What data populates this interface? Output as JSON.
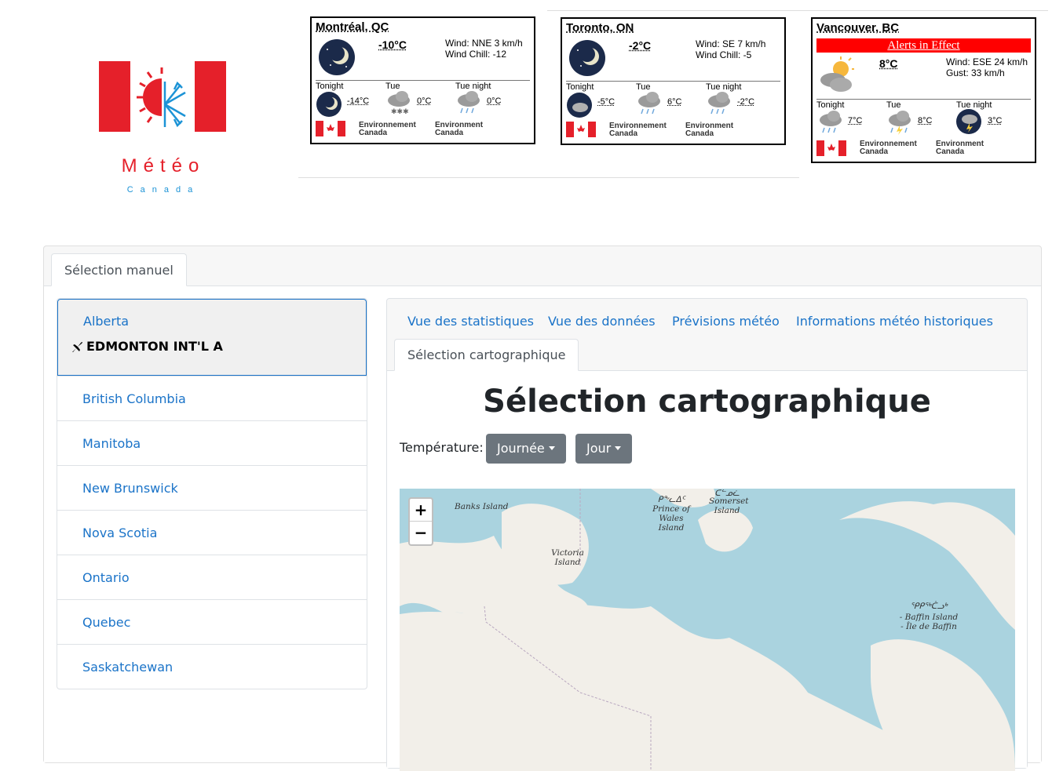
{
  "logo": {
    "word": "Météo",
    "sub": "Canada"
  },
  "weather_widgets": [
    {
      "city": "Montréal, QC",
      "temp": "-10°C",
      "wind": "Wind: NNE 3 km/h",
      "extra": "Wind Chill: -12",
      "alert": "",
      "periods": [
        {
          "label": "Tonight",
          "temp": "-14°C"
        },
        {
          "label": "Tue",
          "temp": "0°C"
        },
        {
          "label": "Tue night",
          "temp": "0°C"
        }
      ],
      "ec_fr": "Environnement Canada",
      "ec_en": "Environment Canada"
    },
    {
      "city": "Toronto, ON",
      "temp": "-2°C",
      "wind": "Wind: SE 7 km/h",
      "extra": "Wind Chill: -5",
      "alert": "",
      "periods": [
        {
          "label": "Tonight",
          "temp": "-5°C"
        },
        {
          "label": "Tue",
          "temp": "6°C"
        },
        {
          "label": "Tue night",
          "temp": "-2°C"
        }
      ],
      "ec_fr": "Environnement Canada",
      "ec_en": "Environment Canada"
    },
    {
      "city": "Vancouver, BC",
      "temp": "8°C",
      "wind": "Wind: ESE 24 km/h",
      "extra": "Gust: 33 km/h",
      "alert": "Alerts in Effect",
      "periods": [
        {
          "label": "Tonight",
          "temp": "7°C"
        },
        {
          "label": "Tue",
          "temp": "8°C"
        },
        {
          "label": "Tue night",
          "temp": "3°C"
        }
      ],
      "ec_fr": "Environnement Canada",
      "ec_en": "Environment Canada"
    }
  ],
  "main_tab": "Sélection manuel",
  "provinces": {
    "active": {
      "name": "Alberta",
      "station": "EDMONTON INT'L A"
    },
    "items": [
      "British Columbia",
      "Manitoba",
      "New Brunswick",
      "Nova Scotia",
      "Ontario",
      "Quebec",
      "Saskatchewan"
    ]
  },
  "right_tabs": [
    "Vue des statistiques",
    "Vue des données",
    "Prévisions météo",
    "Informations météo historiques",
    "Sélection cartographique"
  ],
  "map_section": {
    "title": "Sélection cartographique",
    "temp_label": "Température:",
    "dropdown1": "Journée",
    "dropdown2": "Jour",
    "zoom_in": "+",
    "zoom_out": "−",
    "labels": {
      "banks": "Banks Island",
      "prince_syl": "ᑭᖕᓚᐃᑦ",
      "prince": "Prince of Wales Island",
      "somerset_syl": "ᑕᓪᓄᓛ",
      "somerset": "Somerset Island",
      "victoria": "Victoria Island",
      "baffin_syl": "ᕿᑭᖅᑖᓗᒃ",
      "baffin": "- Baffin Island - Île de Baffin"
    }
  },
  "colors": {
    "link": "#1a73c8",
    "red": "#e5202a",
    "water": "#aad3df",
    "land": "#f2efe9",
    "button": "#6c757d"
  }
}
